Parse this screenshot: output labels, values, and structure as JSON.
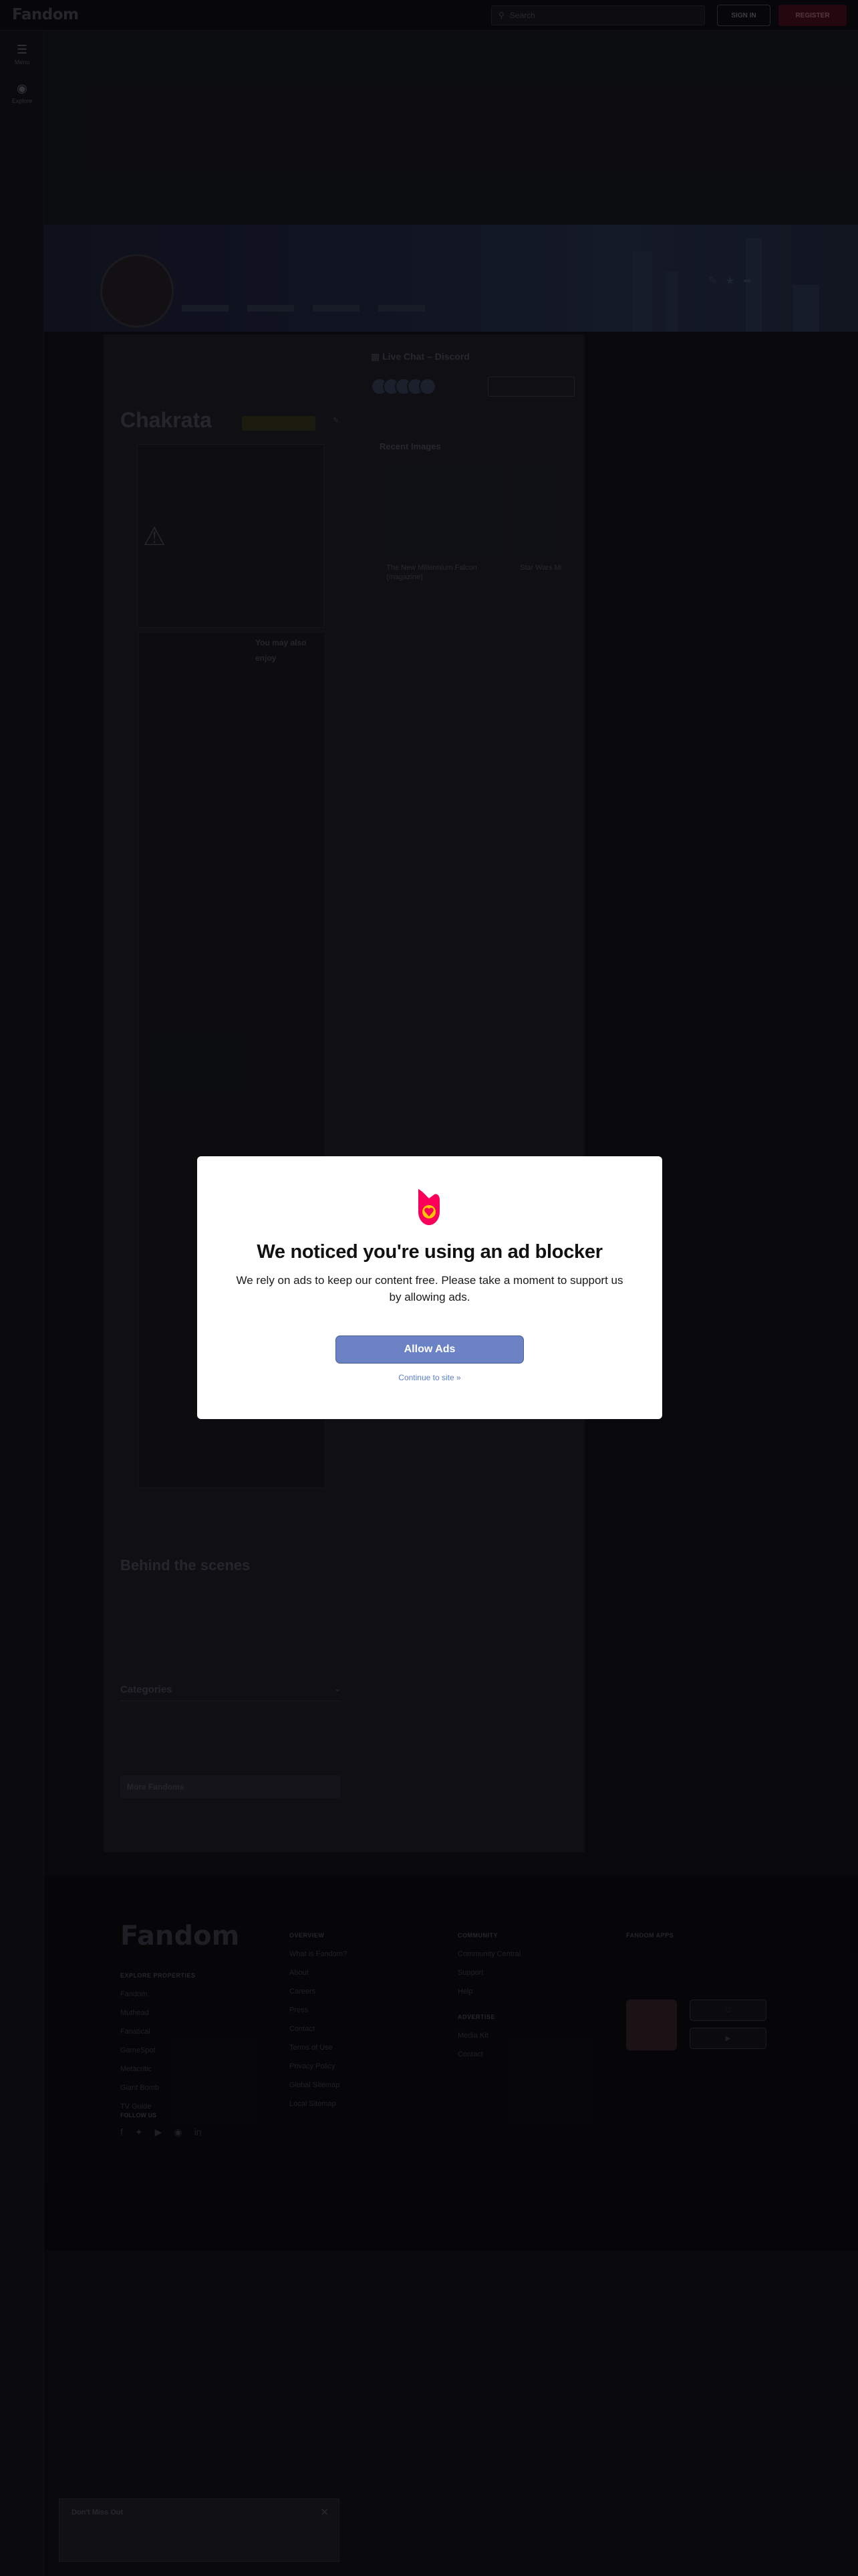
{
  "topbar": {
    "logo_text": "Fandom",
    "search_placeholder": "Search",
    "signin_label": "SIGN IN",
    "register_label": "REGISTER"
  },
  "rail": {
    "menu_label": "Menu",
    "explore_label": "Explore"
  },
  "article": {
    "title": "Chakrata",
    "infobox_heading": "You may also enjoy"
  },
  "sidebar": {
    "chat_title": "Live Chat – Discord",
    "recent_images_title": "Recent Images",
    "recent_images": [
      {
        "caption": "The New Millennium Falcon (magazine)"
      },
      {
        "caption": "Star Wars Millennium Falcon (m..."
      }
    ]
  },
  "content_sections": {
    "behind_the_scenes": "Behind the scenes",
    "categories": "Categories",
    "more_fandoms": "More Fandoms"
  },
  "footer": {
    "logo_text": "Fandom",
    "explore_properties_heading": "EXPLORE PROPERTIES",
    "explore_properties": [
      "Fandom",
      "Muthead",
      "Fanatical",
      "GameSpot",
      "Metacritic",
      "Giant Bomb",
      "TV Guide"
    ],
    "overview_heading": "OVERVIEW",
    "overview": [
      "What is Fandom?",
      "About",
      "Careers",
      "Press",
      "Contact",
      "Terms of Use",
      "Privacy Policy",
      "Global Sitemap",
      "Local Sitemap"
    ],
    "community_heading": "COMMUNITY",
    "community": [
      "Community Central",
      "Support",
      "Help"
    ],
    "advertise_heading": "ADVERTISE",
    "advertise": [
      "Media Kit",
      "Contact"
    ],
    "apps_heading": "FANDOM APPS",
    "follow_heading": "FOLLOW US"
  },
  "cookie_banner": {
    "title": "Don't Miss Out"
  },
  "modal": {
    "title": "We noticed you're using an ad blocker",
    "body": "We rely on ads to keep our content free. Please take a moment to support us by allowing ads.",
    "allow_button": "Allow Ads",
    "continue_link": "Continue to site »"
  },
  "colors": {
    "allow_button": "#6b82c4",
    "continue_link": "#5b7ec9",
    "brand_pink": "#fa005a",
    "brand_orange": "#ffc500"
  }
}
